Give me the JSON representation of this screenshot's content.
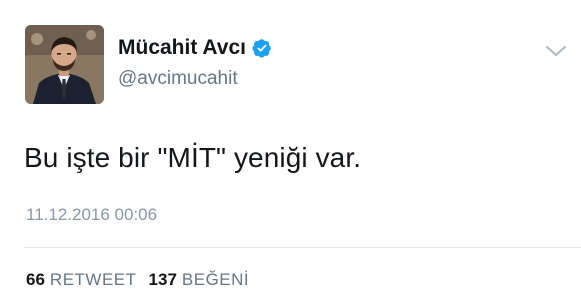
{
  "user": {
    "display_name": "Mücahit Avcı",
    "handle": "@avcimucahit",
    "verified": true
  },
  "tweet": {
    "text": "Bu işte bir \"MİT\" yeniği var.",
    "timestamp": "11.12.2016 00:06"
  },
  "stats": {
    "retweets_count": "66",
    "retweets_label": "RETWEET",
    "likes_count": "137",
    "likes_label": "BEĞENİ"
  },
  "icons": {
    "verified": "verified-badge-icon",
    "menu": "chevron-down-icon"
  },
  "colors": {
    "verified_blue": "#1da1f2",
    "text_primary": "#14171a",
    "text_secondary": "#657786",
    "timestamp": "#8899a6",
    "divider": "#e1e8ed"
  }
}
